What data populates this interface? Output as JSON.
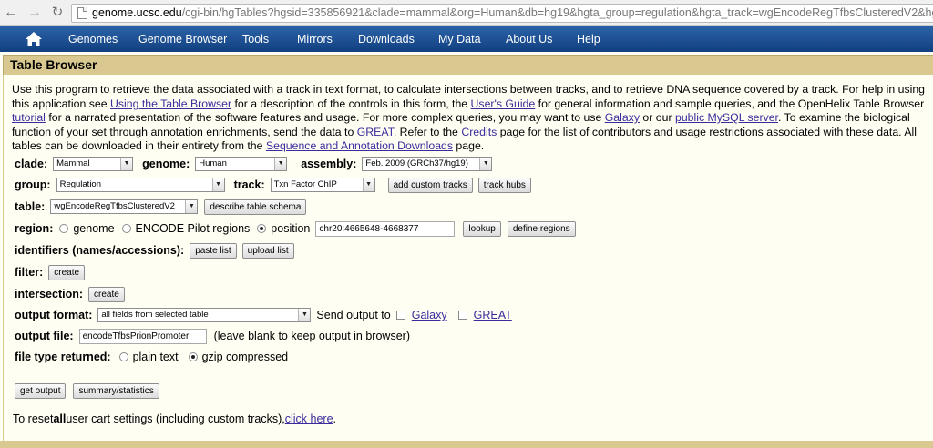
{
  "browser": {
    "url_host": "genome.ucsc.edu",
    "url_path": "/cgi-bin/hgTables?hgsid=335856921&clade=mammal&org=Human&db=hg19&hgta_group=regulation&hgta_track=wgEncodeRegTfbsClusteredV2&hg",
    "back_icon": "back-arrow-icon",
    "forward_icon": "forward-arrow-icon",
    "reload_icon": "reload-icon"
  },
  "menu": {
    "home_icon": "home-icon",
    "items": [
      "Genomes",
      "Genome Browser",
      "Tools",
      "Mirrors",
      "Downloads",
      "My Data",
      "About Us",
      "Help"
    ]
  },
  "page": {
    "title": "Table Browser",
    "intro": {
      "l1": "Use this program to retrieve the data associated with a track in text format, to calculate intersections between tracks, and to retrieve DNA sequence covered by a track. For help in using",
      "l2_a": "this application see ",
      "l2_link1": "Using the Table Browser",
      "l2_b": " for a description of the controls in this form, the ",
      "l2_link2": "User's Guide",
      "l2_c": " for general information and sample queries, and the OpenHelix Table Browser",
      "l3_link1": "tutorial",
      "l3_a": " for a narrated presentation of the software features and usage. For more complex queries, you may want to use ",
      "l3_link2": "Galaxy",
      "l3_b": " or our ",
      "l3_link3": "public MySQL server",
      "l3_c": ". To examine the biological",
      "l4_a": "function of your set through annotation enrichments, send the data to ",
      "l4_link1": "GREAT",
      "l4_b": ". Refer to the ",
      "l4_link2": "Credits",
      "l4_c": " page for the list of contributors and usage restrictions associated with these data. All",
      "l5_a": "tables can be downloaded in their entirety from the ",
      "l5_link1": "Sequence and Annotation Downloads",
      "l5_b": " page."
    }
  },
  "form": {
    "clade_label": "clade:",
    "clade_value": "Mammal",
    "genome_label": "genome:",
    "genome_value": "Human",
    "assembly_label": "assembly:",
    "assembly_value": "Feb. 2009 (GRCh37/hg19)",
    "group_label": "group:",
    "group_value": "Regulation",
    "track_label": "track:",
    "track_value": "Txn Factor ChIP",
    "add_custom_tracks": "add custom tracks",
    "track_hubs": "track hubs",
    "table_label": "table:",
    "table_value": "wgEncodeRegTfbsClusteredV2",
    "describe_schema": "describe table schema",
    "region_label": "region:",
    "region_genome": "genome",
    "region_encode": "ENCODE Pilot regions",
    "region_position": "position",
    "position_value": "chr20:4665648-4668377",
    "lookup": "lookup",
    "define_regions": "define regions",
    "identifiers_label": "identifiers (names/accessions):",
    "paste_list": "paste list",
    "upload_list": "upload list",
    "filter_label": "filter:",
    "filter_create": "create",
    "intersection_label": "intersection:",
    "intersection_create": "create",
    "output_format_label": "output format:",
    "output_format_value": "all fields from selected table",
    "send_output_to": "Send output to",
    "galaxy": "Galaxy",
    "great": "GREAT",
    "output_file_label": "output file:",
    "output_file_value": "encodeTfbsPrionPromoter",
    "output_file_hint": "(leave blank to keep output in browser)",
    "file_type_label": "file type returned:",
    "plain_text": "plain text",
    "gzip": "gzip compressed",
    "get_output": "get output",
    "summary_statistics": "summary/statistics",
    "reset_a": "To reset ",
    "reset_bold": "all",
    "reset_b": " user cart settings (including custom tracks), ",
    "reset_link": "click here",
    "reset_c": "."
  }
}
